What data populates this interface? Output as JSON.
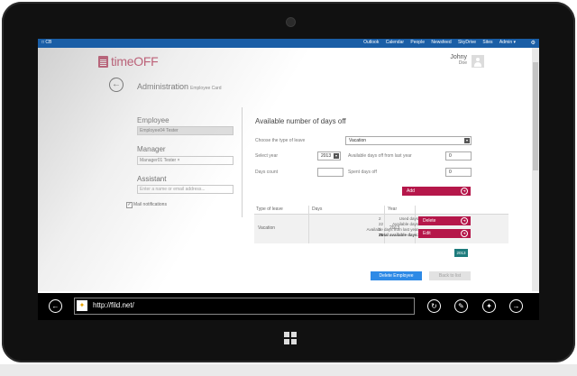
{
  "sharepoint_bar": {
    "site": "□ CB",
    "links": [
      "Outlook",
      "Calendar",
      "People",
      "Newsfeed",
      "SkyDrive",
      "Sites",
      "Admin ▾"
    ],
    "settings_icon": "gear-icon"
  },
  "app": {
    "logo_text": "timeOFF"
  },
  "user": {
    "first_name": "Johny",
    "last_name": "Doe"
  },
  "page": {
    "title": "Administration",
    "subtitle": "Employee Card"
  },
  "employee_panel": {
    "employee_label": "Employee",
    "employee_value": "Employee04 Tester",
    "manager_label": "Manager",
    "manager_value": "Manager01 Tester ×",
    "assistant_label": "Assistant",
    "assistant_placeholder": "Enter a name or email address...",
    "mail_checked": "✓",
    "mail_label": "Mail notifications"
  },
  "days_off": {
    "section_title": "Available number of days off",
    "leave_type_label": "Choose the type of leave",
    "leave_type_value": "Vacation",
    "year_label": "Select year",
    "year_value": "2013",
    "days_count_label": "Days count",
    "days_count_value": "",
    "last_year_label": "Available days off from last year",
    "last_year_value": "0",
    "spent_label": "Spent days off",
    "spent_value": "0",
    "add_button": "Add"
  },
  "table": {
    "headers": [
      "Type of leave",
      "Days",
      "Year"
    ],
    "row": {
      "type": "Vacation",
      "details": [
        {
          "label": "Used days",
          "value": "2"
        },
        {
          "label": "Available days",
          "value": "22"
        },
        {
          "label": "Available days from last year",
          "value": "1"
        },
        {
          "label": "Total available days:",
          "value": "21"
        }
      ],
      "year": "2013",
      "delete_button": "Delete",
      "edit_button": "Edit"
    },
    "year_chip": "2013"
  },
  "actions": {
    "delete_employee": "Delete Employee",
    "back_to_list": "Back to list"
  },
  "browser": {
    "url": "http://fild.net/",
    "favicon": "✦"
  },
  "colors": {
    "accent": "#b5174a",
    "brand_blue": "#1a5ea6",
    "primary_button": "#2e8ae6",
    "year_chip": "#1d7b7c"
  }
}
